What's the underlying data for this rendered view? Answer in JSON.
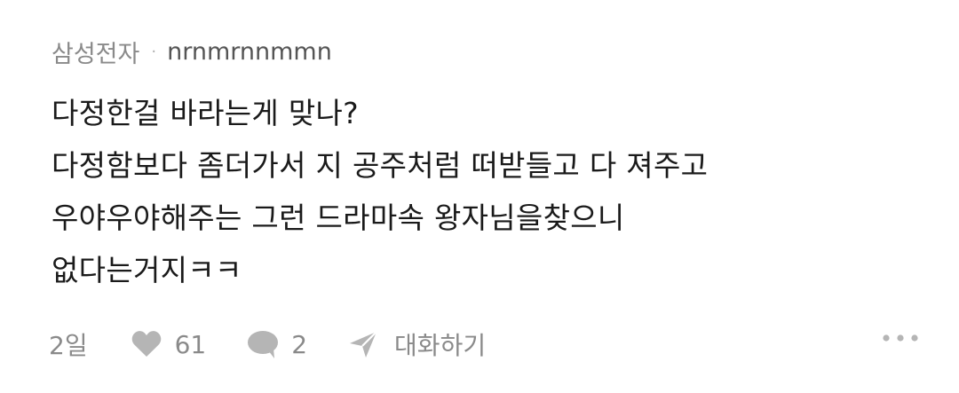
{
  "post": {
    "company": "삼성전자",
    "separator": "·",
    "username": "nrnmrnnmmn",
    "lines": [
      "다정한걸 바라는게 맞나?",
      "다정함보다 좀더가서 지 공주처럼 떠받들고 다 져주고",
      "우야우야해주는 그런 드라마속 왕자님을찾으니",
      "없다는거지ㅋㅋ"
    ]
  },
  "actions": {
    "time": "2일",
    "like_count": "61",
    "comment_count": "2",
    "chat_label": "대화하기",
    "icon_color": "#b5b5b5"
  },
  "icons": {
    "like": "heart-icon",
    "comment": "speech-bubble-icon",
    "chat": "paper-plane-icon",
    "more": "more-dots-icon"
  }
}
